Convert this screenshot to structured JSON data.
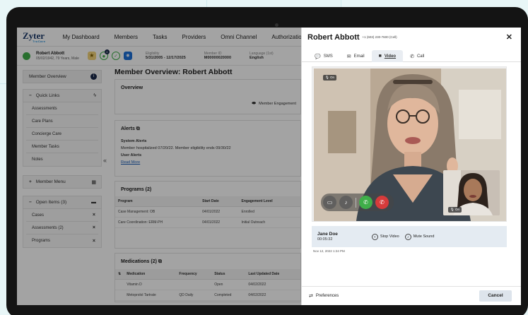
{
  "nav": {
    "logo": "Zyter",
    "logo_sub": "TruCare",
    "items": [
      "My Dashboard",
      "Members",
      "Tasks",
      "Providers",
      "Omni Channel",
      "Authorization"
    ]
  },
  "patient": {
    "name": "Robert Abbott",
    "meta": "05/02/1942, 79 Years, Male",
    "badge_count": "4",
    "eligibility_label": "Eligibility",
    "eligibility_value": "5/31/2005 - 12/17/2025",
    "member_id_label": "Member ID",
    "member_id_value": "M00000020000",
    "language_label": "Language (1st)",
    "language_value": "English"
  },
  "sidebar": {
    "member_overview": "Member Overview",
    "quick_links": "Quick Links",
    "links": [
      "Assessments",
      "Care Plans",
      "Concierge Care",
      "Member Tasks",
      "Notes"
    ],
    "member_menu": "Member Menu",
    "open_items": "Open Items (3)",
    "open_links": [
      "Cases",
      "Assessments (2)",
      "Programs"
    ]
  },
  "main": {
    "title": "Member Overview: Robert Abbott",
    "overview_title": "Overview",
    "engagement_button": "Member Engagement",
    "alerts_title": "Alerts",
    "system_alerts_label": "System Alerts",
    "system_alerts_text": "Member hospitalized 07/20/22. Member eligibility ends 09/30/22",
    "user_alerts_label": "User Alerts",
    "read_more": "Read More",
    "programs_title": "Programs (2)",
    "programs_headers": [
      "Program",
      "Start Date",
      "Engagement Level"
    ],
    "programs_rows": [
      [
        "Case Management: OB",
        "04/01/2022",
        "Enrolled"
      ],
      [
        "Care Coordination: ERM-PH",
        "04/01/2022",
        "Initial Outreach"
      ]
    ],
    "medications_title": "Medications (2)",
    "meds_headers": [
      "Medication",
      "Frequency",
      "Status",
      "Last Updated Date"
    ],
    "meds_rows": [
      [
        "Vitamin D",
        "",
        "Open",
        "04/02/2022"
      ],
      [
        "Metoprolol Tartrate",
        "QD Daily",
        "Completed",
        "04/02/2022"
      ]
    ]
  },
  "panel": {
    "name": "Robert Abbott",
    "phone": "+1 (603) 230-7600 (Cell)",
    "tabs": [
      "SMS",
      "Email",
      "Video",
      "Call"
    ],
    "active_tab": "Video",
    "video_badge": "On",
    "pip_badge": "On",
    "caller_name": "Jane Doe",
    "call_time": "00:05:32",
    "stop_video": "Stop Video",
    "mute_sound": "Mute Sound",
    "date": "Nov 12, 2022 1:24 PM",
    "preferences": "Preferences",
    "cancel": "Cancel"
  },
  "colors": {
    "background": "#e8f6f7",
    "bezel": "#141414",
    "accent_navy": "#1a2a4a",
    "call_green": "#3fae49",
    "end_red": "#d63b3b",
    "callbar": "#e4ebf2"
  },
  "icons": {
    "sms": "chat-bubble-icon",
    "email": "envelope-icon",
    "video": "video-camera-icon",
    "call": "phone-icon",
    "close": "close-icon",
    "preferences": "sliders-icon"
  }
}
